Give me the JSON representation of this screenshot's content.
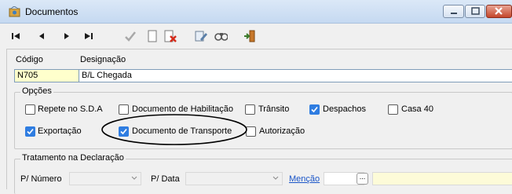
{
  "window": {
    "title": "Documentos",
    "minimize_icon": "minimize-icon",
    "maximize_icon": "maximize-icon",
    "close_icon": "close-icon"
  },
  "toolbar": {
    "icons": [
      "first-record-icon",
      "previous-record-icon",
      "next-record-icon",
      "last-record-icon",
      "confirm-icon",
      "new-document-icon",
      "delete-document-icon",
      "edit-icon",
      "search-icon",
      "exit-icon"
    ]
  },
  "form": {
    "codigo_label": "Código",
    "codigo_value": "N705",
    "designacao_label": "Designação",
    "designacao_value": "B/L Chegada"
  },
  "opcoes": {
    "legend": "Opções",
    "options": [
      {
        "label": "Repete no S.D.A",
        "checked": false
      },
      {
        "label": "Documento de Habilitação",
        "checked": false
      },
      {
        "label": "Trânsito",
        "checked": false
      },
      {
        "label": "Despachos",
        "checked": true
      },
      {
        "label": "Casa 40",
        "checked": false
      },
      {
        "label": "Exportação",
        "checked": true
      },
      {
        "label": "Documento de Transporte",
        "checked": true
      },
      {
        "label": "Autorização",
        "checked": false
      }
    ]
  },
  "tratamento": {
    "legend": "Tratamento na Declaração",
    "pnumero_label": "P/ Número",
    "pnumero_value": "",
    "pdata_label": "P/ Data",
    "pdata_value": "",
    "mencao_label": "Menção",
    "mencao_value": "",
    "ellipsis_label": "...",
    "mencao_desc_value": ""
  },
  "colors": {
    "checkbox_checked": "#2f7de1",
    "codigo_field_bg": "#ffffcc",
    "mencao_desc_bg": "#fdfbd8",
    "link": "#1a55c8"
  }
}
